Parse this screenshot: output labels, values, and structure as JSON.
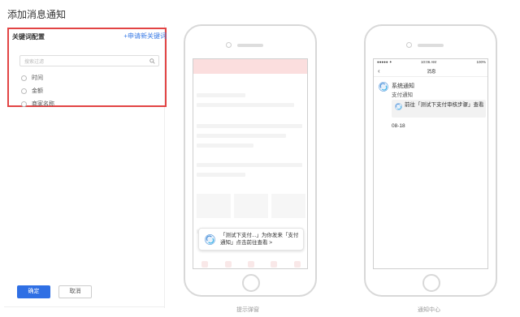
{
  "page": {
    "title": "添加消息通知"
  },
  "keywords": {
    "title": "关键词配置",
    "add_link": "+申请新关键词",
    "search_placeholder": "搜索过滤",
    "options": [
      "时间",
      "金额",
      "商家名称"
    ]
  },
  "actions": {
    "confirm": "确定",
    "cancel": "取消"
  },
  "phone_popup": {
    "caption": "提示弹窗",
    "notification_text": "「测试下支付...」为你发来「支付通知」点击前往查看 >"
  },
  "phone_center": {
    "caption": "通知中心",
    "status_left": "●●●●● ✦",
    "status_time": "10:06 AM",
    "status_right": "100%",
    "header_title": "消息",
    "back": "‹",
    "sender": "系统通知",
    "subtitle": "支付通知",
    "message": "前往「测试下支付审核步骤」查看",
    "date": "08-18"
  },
  "colors": {
    "accent": "#2f6fe4",
    "highlight_border": "#e24444",
    "link": "#3b7ce6"
  }
}
